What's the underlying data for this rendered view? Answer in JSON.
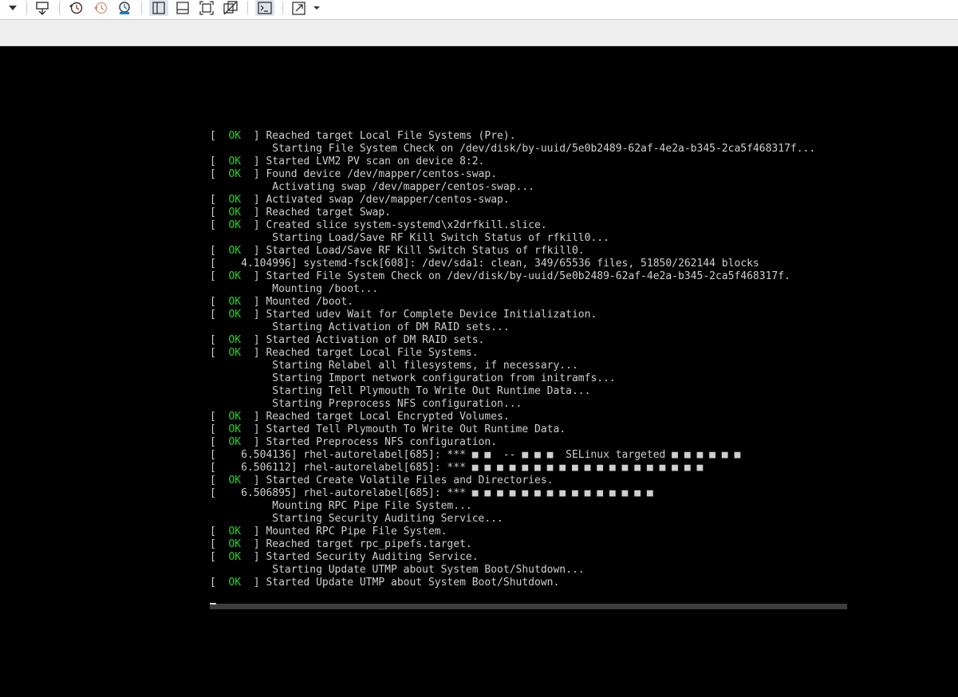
{
  "toolbar": {
    "icons": [
      "dropdown-arrow-icon",
      "send-ctrl-alt-del-icon",
      "snapshot-icon",
      "revert-snapshot-icon",
      "snapshot-manager-icon",
      "show-library-icon",
      "thumbnail-bar-icon",
      "full-screen-icon",
      "unity-icon",
      "console-view-icon",
      "stretch-guest-icon"
    ]
  },
  "console": {
    "lines": [
      {
        "status": "OK",
        "text": "Reached target Local File Systems (Pre)."
      },
      {
        "status": "",
        "text": "Starting File System Check on /dev/disk/by-uuid/5e0b2489-62af-4e2a-b345-2ca5f468317f..."
      },
      {
        "status": "OK",
        "text": "Started LVM2 PV scan on device 8:2."
      },
      {
        "status": "OK",
        "text": "Found device /dev/mapper/centos-swap."
      },
      {
        "status": "",
        "text": "Activating swap /dev/mapper/centos-swap..."
      },
      {
        "status": "OK",
        "text": "Activated swap /dev/mapper/centos-swap."
      },
      {
        "status": "OK",
        "text": "Reached target Swap."
      },
      {
        "status": "OK",
        "text": "Created slice system-systemd\\x2drfkill.slice."
      },
      {
        "status": "",
        "text": "Starting Load/Save RF Kill Switch Status of rfkill0..."
      },
      {
        "status": "OK",
        "text": "Started Load/Save RF Kill Switch Status of rfkill0."
      },
      {
        "raw": "[    4.104996] systemd-fsck[608]: /dev/sda1: clean, 349/65536 files, 51850/262144 blocks"
      },
      {
        "status": "OK",
        "text": "Started File System Check on /dev/disk/by-uuid/5e0b2489-62af-4e2a-b345-2ca5f468317f."
      },
      {
        "status": "",
        "text": "Mounting /boot..."
      },
      {
        "status": "OK",
        "text": "Mounted /boot."
      },
      {
        "status": "OK",
        "text": "Started udev Wait for Complete Device Initialization."
      },
      {
        "status": "",
        "text": "Starting Activation of DM RAID sets..."
      },
      {
        "status": "OK",
        "text": "Started Activation of DM RAID sets."
      },
      {
        "status": "OK",
        "text": "Reached target Local File Systems."
      },
      {
        "status": "",
        "text": "Starting Relabel all filesystems, if necessary..."
      },
      {
        "status": "",
        "text": "Starting Import network configuration from initramfs..."
      },
      {
        "status": "",
        "text": "Starting Tell Plymouth To Write Out Runtime Data..."
      },
      {
        "status": "",
        "text": "Starting Preprocess NFS configuration..."
      },
      {
        "status": "OK",
        "text": "Reached target Local Encrypted Volumes."
      },
      {
        "status": "OK",
        "text": "Started Tell Plymouth To Write Out Runtime Data."
      },
      {
        "status": "OK",
        "text": "Started Preprocess NFS configuration."
      },
      {
        "raw": "[    6.504136] rhel-autorelabel[685]: *** ■ ■  -- ■ ■ ■  SELinux targeted ■ ■ ■ ■ ■ ■"
      },
      {
        "raw": "[    6.506112] rhel-autorelabel[685]: *** ■ ■ ■ ■ ■ ■ ■ ■ ■ ■ ■ ■ ■ ■ ■ ■ ■ ■ ■"
      },
      {
        "status": "OK",
        "text": "Started Create Volatile Files and Directories."
      },
      {
        "raw": "[    6.506895] rhel-autorelabel[685]: *** ■ ■ ■ ■ ■ ■ ■ ■ ■ ■ ■ ■ ■ ■ ■"
      },
      {
        "status": "",
        "text": "Mounting RPC Pipe File System..."
      },
      {
        "status": "",
        "text": "Starting Security Auditing Service..."
      },
      {
        "status": "OK",
        "text": "Mounted RPC Pipe File System."
      },
      {
        "status": "OK",
        "text": "Reached target rpc_pipefs.target."
      },
      {
        "status": "OK",
        "text": "Started Security Auditing Service."
      },
      {
        "status": "",
        "text": "Starting Update UTMP about System Boot/Shutdown..."
      },
      {
        "status": "OK",
        "text": "Started Update UTMP about System Boot/Shutdown."
      }
    ]
  },
  "colors": {
    "ok": "#29d229",
    "text": "#cfcfcf",
    "console_bg": "#000000"
  }
}
